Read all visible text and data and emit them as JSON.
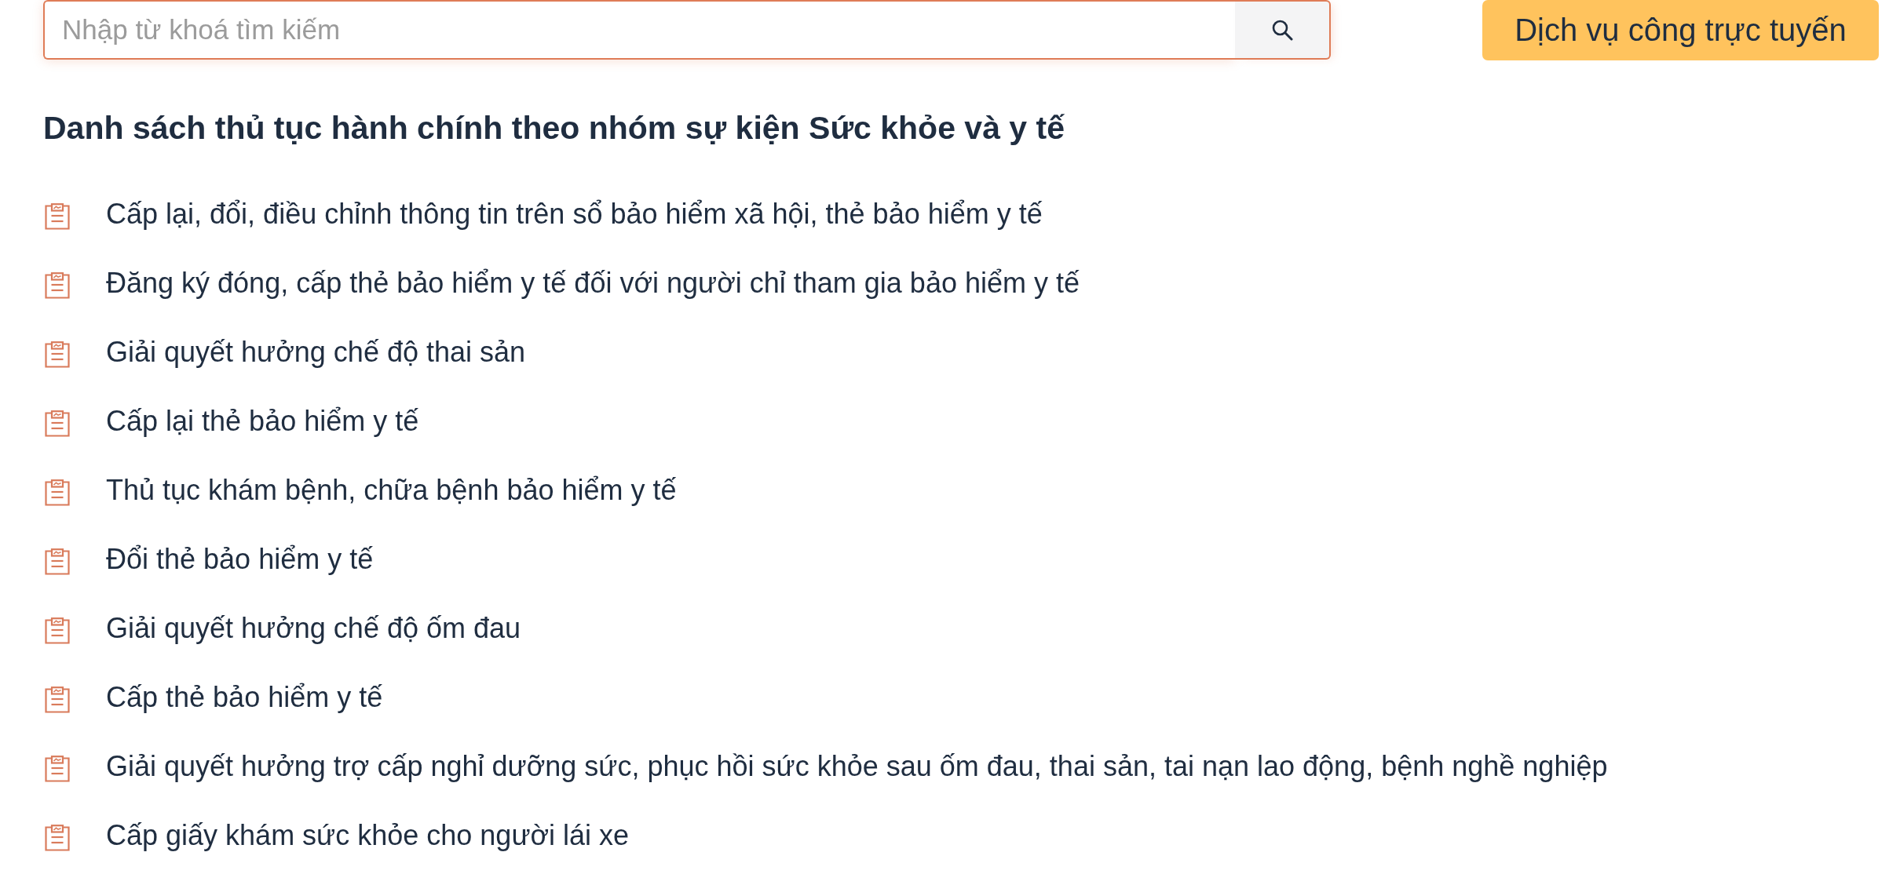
{
  "search": {
    "placeholder": "Nhập từ khoá tìm kiếm"
  },
  "online_services_button": {
    "label": "Dịch vụ công trực tuyến"
  },
  "heading": "Danh sách thủ tục hành chính theo nhóm sự kiện Sức khỏe và y tế",
  "procedures": [
    {
      "label": "Cấp lại, đổi, điều chỉnh thông tin trên sổ bảo hiểm xã hội, thẻ bảo hiểm y tế"
    },
    {
      "label": "Đăng ký đóng, cấp thẻ bảo hiểm y tế đối với người chỉ tham gia bảo hiểm y tế"
    },
    {
      "label": "Giải quyết hưởng chế độ thai sản"
    },
    {
      "label": "Cấp lại thẻ bảo hiểm y tế"
    },
    {
      "label": "Thủ tục khám bệnh, chữa bệnh bảo hiểm y tế"
    },
    {
      "label": "Đổi thẻ bảo hiểm y tế"
    },
    {
      "label": "Giải quyết hưởng chế độ ốm đau"
    },
    {
      "label": "Cấp thẻ bảo hiểm y tế"
    },
    {
      "label": "Giải quyết hưởng trợ cấp nghỉ dưỡng sức, phục hồi sức khỏe sau ốm đau, thai sản, tai nạn lao động, bệnh nghề nghiệp"
    },
    {
      "label": "Cấp giấy khám sức khỏe cho người lái xe"
    }
  ]
}
